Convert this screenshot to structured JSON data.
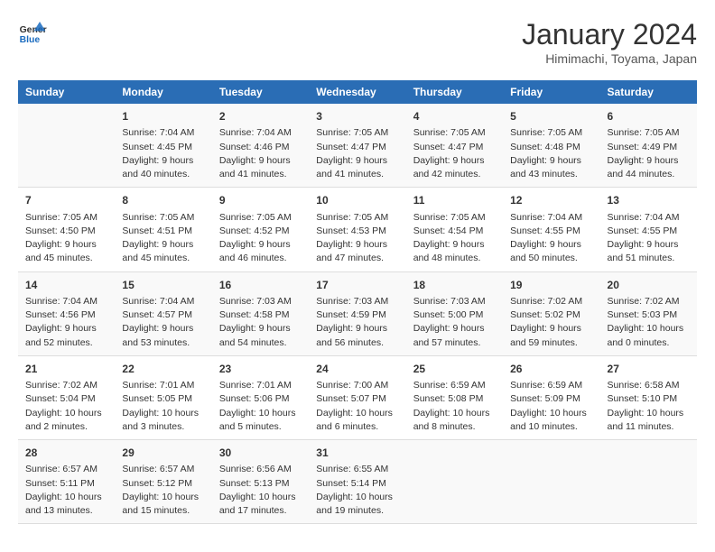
{
  "header": {
    "logo_line1": "General",
    "logo_line2": "Blue",
    "month": "January 2024",
    "location": "Himimachi, Toyama, Japan"
  },
  "days_of_week": [
    "Sunday",
    "Monday",
    "Tuesday",
    "Wednesday",
    "Thursday",
    "Friday",
    "Saturday"
  ],
  "weeks": [
    [
      {
        "day": "",
        "info": ""
      },
      {
        "day": "1",
        "info": "Sunrise: 7:04 AM\nSunset: 4:45 PM\nDaylight: 9 hours\nand 40 minutes."
      },
      {
        "day": "2",
        "info": "Sunrise: 7:04 AM\nSunset: 4:46 PM\nDaylight: 9 hours\nand 41 minutes."
      },
      {
        "day": "3",
        "info": "Sunrise: 7:05 AM\nSunset: 4:47 PM\nDaylight: 9 hours\nand 41 minutes."
      },
      {
        "day": "4",
        "info": "Sunrise: 7:05 AM\nSunset: 4:47 PM\nDaylight: 9 hours\nand 42 minutes."
      },
      {
        "day": "5",
        "info": "Sunrise: 7:05 AM\nSunset: 4:48 PM\nDaylight: 9 hours\nand 43 minutes."
      },
      {
        "day": "6",
        "info": "Sunrise: 7:05 AM\nSunset: 4:49 PM\nDaylight: 9 hours\nand 44 minutes."
      }
    ],
    [
      {
        "day": "7",
        "info": "Sunrise: 7:05 AM\nSunset: 4:50 PM\nDaylight: 9 hours\nand 45 minutes."
      },
      {
        "day": "8",
        "info": "Sunrise: 7:05 AM\nSunset: 4:51 PM\nDaylight: 9 hours\nand 45 minutes."
      },
      {
        "day": "9",
        "info": "Sunrise: 7:05 AM\nSunset: 4:52 PM\nDaylight: 9 hours\nand 46 minutes."
      },
      {
        "day": "10",
        "info": "Sunrise: 7:05 AM\nSunset: 4:53 PM\nDaylight: 9 hours\nand 47 minutes."
      },
      {
        "day": "11",
        "info": "Sunrise: 7:05 AM\nSunset: 4:54 PM\nDaylight: 9 hours\nand 48 minutes."
      },
      {
        "day": "12",
        "info": "Sunrise: 7:04 AM\nSunset: 4:55 PM\nDaylight: 9 hours\nand 50 minutes."
      },
      {
        "day": "13",
        "info": "Sunrise: 7:04 AM\nSunset: 4:55 PM\nDaylight: 9 hours\nand 51 minutes."
      }
    ],
    [
      {
        "day": "14",
        "info": "Sunrise: 7:04 AM\nSunset: 4:56 PM\nDaylight: 9 hours\nand 52 minutes."
      },
      {
        "day": "15",
        "info": "Sunrise: 7:04 AM\nSunset: 4:57 PM\nDaylight: 9 hours\nand 53 minutes."
      },
      {
        "day": "16",
        "info": "Sunrise: 7:03 AM\nSunset: 4:58 PM\nDaylight: 9 hours\nand 54 minutes."
      },
      {
        "day": "17",
        "info": "Sunrise: 7:03 AM\nSunset: 4:59 PM\nDaylight: 9 hours\nand 56 minutes."
      },
      {
        "day": "18",
        "info": "Sunrise: 7:03 AM\nSunset: 5:00 PM\nDaylight: 9 hours\nand 57 minutes."
      },
      {
        "day": "19",
        "info": "Sunrise: 7:02 AM\nSunset: 5:02 PM\nDaylight: 9 hours\nand 59 minutes."
      },
      {
        "day": "20",
        "info": "Sunrise: 7:02 AM\nSunset: 5:03 PM\nDaylight: 10 hours\nand 0 minutes."
      }
    ],
    [
      {
        "day": "21",
        "info": "Sunrise: 7:02 AM\nSunset: 5:04 PM\nDaylight: 10 hours\nand 2 minutes."
      },
      {
        "day": "22",
        "info": "Sunrise: 7:01 AM\nSunset: 5:05 PM\nDaylight: 10 hours\nand 3 minutes."
      },
      {
        "day": "23",
        "info": "Sunrise: 7:01 AM\nSunset: 5:06 PM\nDaylight: 10 hours\nand 5 minutes."
      },
      {
        "day": "24",
        "info": "Sunrise: 7:00 AM\nSunset: 5:07 PM\nDaylight: 10 hours\nand 6 minutes."
      },
      {
        "day": "25",
        "info": "Sunrise: 6:59 AM\nSunset: 5:08 PM\nDaylight: 10 hours\nand 8 minutes."
      },
      {
        "day": "26",
        "info": "Sunrise: 6:59 AM\nSunset: 5:09 PM\nDaylight: 10 hours\nand 10 minutes."
      },
      {
        "day": "27",
        "info": "Sunrise: 6:58 AM\nSunset: 5:10 PM\nDaylight: 10 hours\nand 11 minutes."
      }
    ],
    [
      {
        "day": "28",
        "info": "Sunrise: 6:57 AM\nSunset: 5:11 PM\nDaylight: 10 hours\nand 13 minutes."
      },
      {
        "day": "29",
        "info": "Sunrise: 6:57 AM\nSunset: 5:12 PM\nDaylight: 10 hours\nand 15 minutes."
      },
      {
        "day": "30",
        "info": "Sunrise: 6:56 AM\nSunset: 5:13 PM\nDaylight: 10 hours\nand 17 minutes."
      },
      {
        "day": "31",
        "info": "Sunrise: 6:55 AM\nSunset: 5:14 PM\nDaylight: 10 hours\nand 19 minutes."
      },
      {
        "day": "",
        "info": ""
      },
      {
        "day": "",
        "info": ""
      },
      {
        "day": "",
        "info": ""
      }
    ]
  ]
}
